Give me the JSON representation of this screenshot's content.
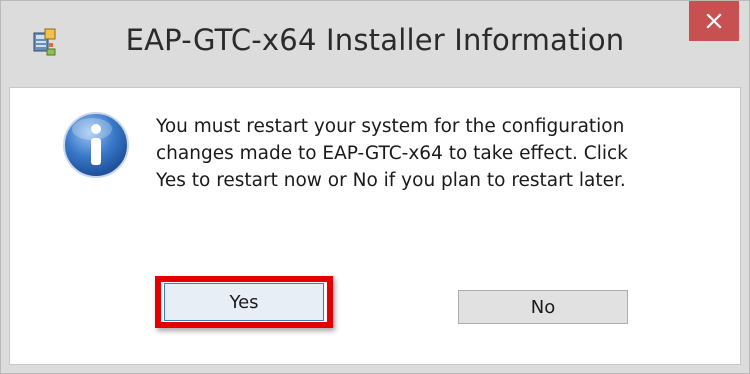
{
  "window": {
    "title": "EAP-GTC-x64 Installer Information",
    "app_icon": "installer-icon",
    "close_icon": "close-icon",
    "close_color": "#c75050"
  },
  "dialog": {
    "icon": "info-icon",
    "message_lines": [
      "You must restart your system for the configuration",
      "changes made to EAP-GTC-x64 to take effect. Click",
      "Yes to restart now or No if you plan to restart later."
    ]
  },
  "buttons": {
    "yes_label": "Yes",
    "no_label": "No"
  },
  "annotation": {
    "highlight_color": "#e30000",
    "highlight_target": "Yes"
  }
}
